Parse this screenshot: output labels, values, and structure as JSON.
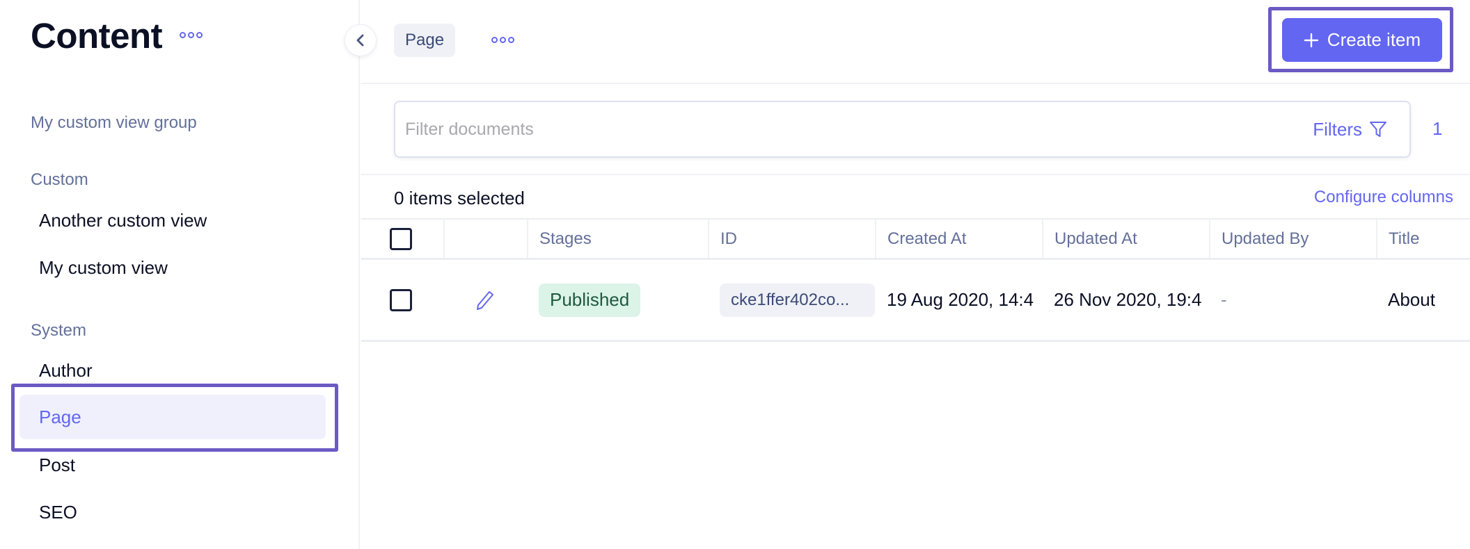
{
  "sidebar": {
    "title": "Content",
    "more_icon": "more-horizontal-icon",
    "group_link": "My custom view group",
    "sections": [
      {
        "label": "Custom",
        "items": [
          "Another custom view",
          "My custom view"
        ]
      },
      {
        "label": "System",
        "items": [
          "Author",
          "Page",
          "Post",
          "SEO"
        ]
      }
    ],
    "active_item": "Page"
  },
  "header": {
    "collapse_icon": "chevron-left-icon",
    "breadcrumb": "Page",
    "more_icon": "more-horizontal-icon",
    "create_button": {
      "icon": "plus-icon",
      "label": "Create item"
    }
  },
  "filter": {
    "placeholder": "Filter documents",
    "value": "",
    "filters_label": "Filters",
    "filters_icon": "funnel-icon",
    "count": "1"
  },
  "selection": {
    "text": "0 items selected",
    "configure_columns": "Configure columns"
  },
  "table": {
    "columns": [
      "",
      "",
      "Stages",
      "ID",
      "Created At",
      "Updated At",
      "Updated By",
      "Title"
    ],
    "rows": [
      {
        "checked": false,
        "edit_icon": "pencil-icon",
        "stage": "Published",
        "id": "cke1ffer402co...",
        "created_at": "19 Aug 2020, 14:4",
        "updated_at": "26 Nov 2020, 19:4",
        "updated_by": "-",
        "title": "About"
      }
    ]
  },
  "colors": {
    "accent": "#6366f1",
    "highlight_outline": "#6c5ac4",
    "published_bg": "#dcf3e8",
    "published_text": "#1f5a3c",
    "muted_text": "#64709a"
  }
}
